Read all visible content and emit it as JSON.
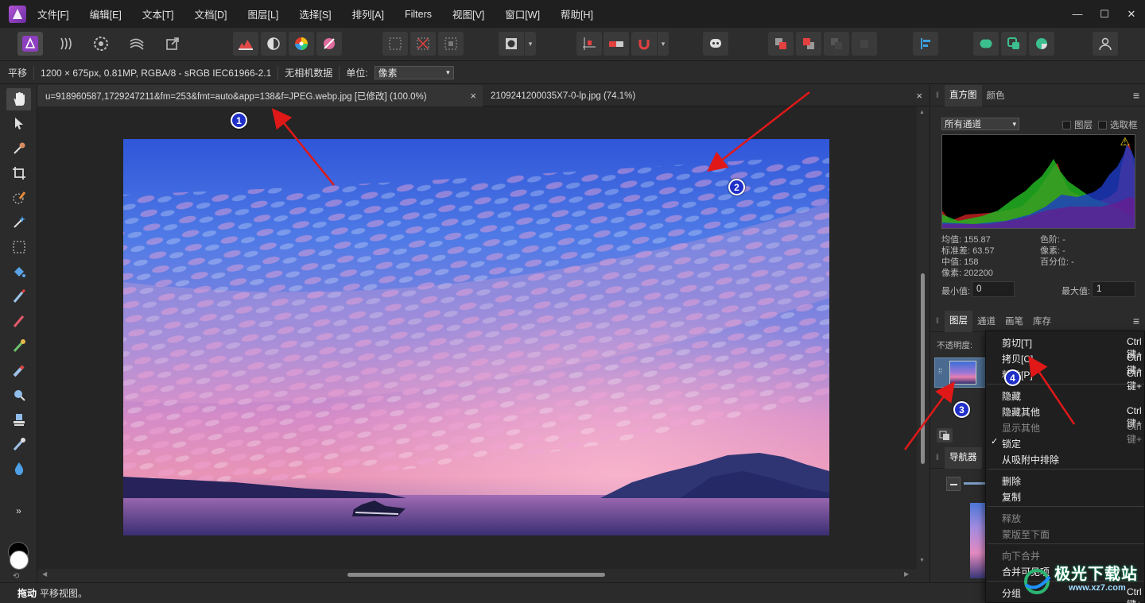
{
  "menubar": {
    "items": [
      "文件[F]",
      "编辑[E]",
      "文本[T]",
      "文档[D]",
      "图层[L]",
      "选择[S]",
      "排列[A]",
      "Filters",
      "视图[V]",
      "窗口[W]",
      "帮助[H]"
    ],
    "minimize": "—",
    "maximize": "☐",
    "close": "✕"
  },
  "contextbar": {
    "mode": "平移",
    "info": "1200 × 675px, 0.81MP, RGBA/8 - sRGB IEC61966-2.1",
    "camera": "无相机数据",
    "unit_label": "单位:",
    "unit_value": "像素"
  },
  "tabs": [
    {
      "label": "u=918960587,1729247211&fm=253&fmt=auto&app=138&f=JPEG.webp.jpg [已修改] (100.0%)",
      "close": "×"
    },
    {
      "label": "2109241200035X7-0-lp.jpg (74.1%)",
      "close": "×"
    }
  ],
  "statusbar": {
    "action": "拖动",
    "text": "平移视图。"
  },
  "histogram_panel": {
    "tabs": [
      "直方图",
      "颜色"
    ],
    "channel": "所有通道",
    "checkbox_layer": "图层",
    "checkbox_marquee": "选取框",
    "stats_left": [
      "均值: 155.87",
      "标准差: 63.57",
      "中值: 158",
      "像素: 202200"
    ],
    "stats_right": [
      "色阶: -",
      "像素: -",
      "百分位: -"
    ],
    "min_label": "最小值:",
    "min_value": "0",
    "max_label": "最大值:",
    "max_value": "1",
    "warning_icon": "⚠"
  },
  "layers_panel": {
    "tabs": [
      "图层",
      "通道",
      "画笔",
      "库存"
    ],
    "opacity_label": "不透明度:"
  },
  "navigator_panel": {
    "tabs": [
      "导航器"
    ]
  },
  "context_menu": {
    "items": [
      {
        "label": "剪切[T]",
        "shortcut": "Ctrl 键+",
        "disabled": false
      },
      {
        "label": "拷贝[C]",
        "shortcut": "Ctrl 键+",
        "disabled": false
      },
      {
        "label": "粘贴[P]",
        "shortcut": "Ctrl 键+",
        "disabled": false
      },
      {
        "label": "隐藏",
        "shortcut": "",
        "disabled": false
      },
      {
        "label": "隐藏其他",
        "shortcut": "Ctrl 键+",
        "disabled": false
      },
      {
        "label": "显示其他",
        "shortcut": "Ctrl 键+",
        "disabled": true
      },
      {
        "label": "锁定",
        "shortcut": "",
        "disabled": false,
        "checked": true
      },
      {
        "label": "从吸附中排除",
        "shortcut": "",
        "disabled": false
      },
      {
        "label": "删除",
        "shortcut": "",
        "disabled": false
      },
      {
        "label": "复制",
        "shortcut": "",
        "disabled": false
      },
      {
        "label": "释放",
        "shortcut": "",
        "disabled": true
      },
      {
        "label": "蒙版至下面",
        "shortcut": "",
        "disabled": true
      },
      {
        "label": "向下合并",
        "shortcut": "",
        "disabled": true
      },
      {
        "label": "合并可见项",
        "shortcut": "",
        "disabled": false
      },
      {
        "label": "分组",
        "shortcut": "Ctrl 键+",
        "disabled": false
      }
    ],
    "check_mark": "✓"
  },
  "annotations": {
    "badges": [
      "1",
      "2",
      "3",
      "4"
    ]
  },
  "watermark": {
    "text": "极光下载站",
    "url": "www.xz7.com"
  },
  "tools_panel": {
    "more": "»"
  },
  "colors": {
    "accent": "#9b4dca",
    "annotation_arrow": "#e01818",
    "badge": "#1f2fc8",
    "selected_layer": "#4a6b8f"
  }
}
